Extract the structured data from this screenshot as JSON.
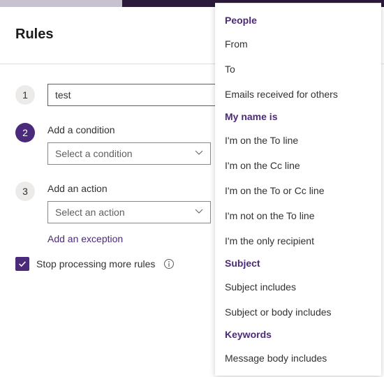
{
  "page": {
    "title": "Rules"
  },
  "step1": {
    "number": "1",
    "value": "test"
  },
  "step2": {
    "number": "2",
    "label": "Add a condition",
    "select_placeholder": "Select a condition"
  },
  "step3": {
    "number": "3",
    "label": "Add an action",
    "select_placeholder": "Select an action",
    "exception_link": "Add an exception"
  },
  "stop_processing": {
    "label": "Stop processing more rules",
    "checked": true
  },
  "dropdown": {
    "groups": [
      {
        "header": "People",
        "items": [
          "From",
          "To",
          "Emails received for others"
        ]
      },
      {
        "header": "My name is",
        "items": [
          "I'm on the To line",
          "I'm on the Cc line",
          "I'm on the To or Cc line",
          "I'm not on the To line",
          "I'm the only recipient"
        ]
      },
      {
        "header": "Subject",
        "items": [
          "Subject includes",
          "Subject or body includes"
        ]
      },
      {
        "header": "Keywords",
        "items": [
          "Message body includes"
        ]
      }
    ]
  }
}
